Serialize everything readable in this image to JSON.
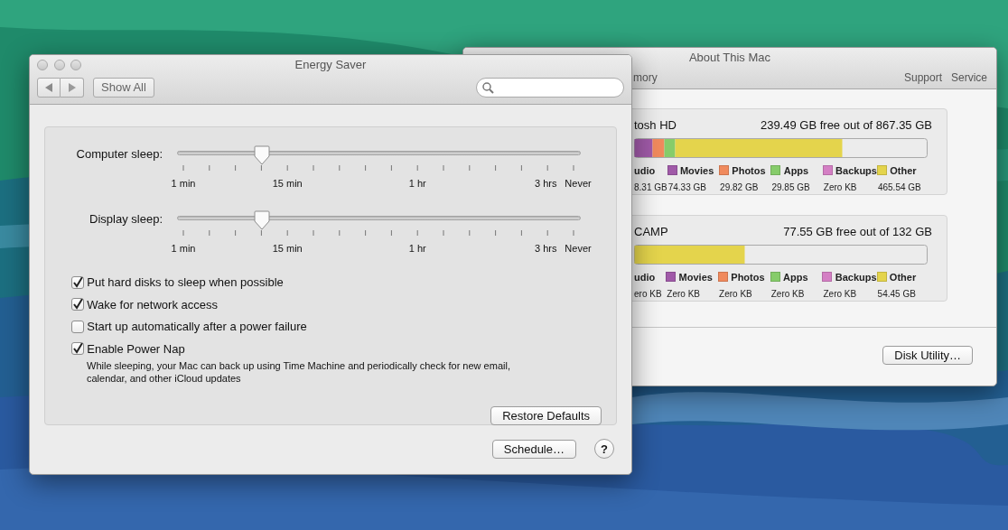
{
  "about_window": {
    "title": "About This Mac",
    "toolbar_left": [
      "mory"
    ],
    "toolbar_right": [
      "Support",
      "Service"
    ],
    "disks": [
      {
        "name": "tosh HD",
        "free": "239.49 GB free out of 867.35 GB",
        "legend": [
          {
            "label": "udio",
            "value": "8.31 GB"
          },
          {
            "label": "Movies",
            "value": "74.33 GB",
            "color": "#a05aa8"
          },
          {
            "label": "Photos",
            "value": "29.82 GB",
            "color": "#f08a5d"
          },
          {
            "label": "Apps",
            "value": "29.85 GB",
            "color": "#86cc6a"
          },
          {
            "label": "Backups",
            "value": "Zero KB",
            "color": "#d47fc4"
          },
          {
            "label": "Other",
            "value": "465.54 GB",
            "color": "#e4d44c"
          }
        ]
      },
      {
        "name": "CAMP",
        "free": "77.55 GB free out of 132 GB",
        "legend": [
          {
            "label": "udio",
            "value": "ero KB"
          },
          {
            "label": "Movies",
            "value": "Zero KB",
            "color": "#a05aa8"
          },
          {
            "label": "Photos",
            "value": "Zero KB",
            "color": "#f08a5d"
          },
          {
            "label": "Apps",
            "value": "Zero KB",
            "color": "#86cc6a"
          },
          {
            "label": "Backups",
            "value": "Zero KB",
            "color": "#d47fc4"
          },
          {
            "label": "Other",
            "value": "54.45 GB",
            "color": "#e4d44c"
          }
        ]
      }
    ],
    "button": "Disk Utility…"
  },
  "energy_window": {
    "title": "Energy Saver",
    "show_all": "Show All",
    "sliders": [
      {
        "label": "Computer sleep:",
        "level": 0.21,
        "ticks": [
          "1 min",
          "15 min",
          "1 hr",
          "3 hrs",
          "Never"
        ]
      },
      {
        "label": "Display sleep:",
        "level": 0.21,
        "ticks": [
          "1 min",
          "15 min",
          "1 hr",
          "3 hrs",
          "Never"
        ]
      }
    ],
    "checkboxes": [
      {
        "label": "Put hard disks to sleep when possible",
        "checked": true
      },
      {
        "label": "Wake for network access",
        "checked": true
      },
      {
        "label": "Start up automatically after a power failure",
        "checked": false
      },
      {
        "label": "Enable Power Nap",
        "checked": true,
        "description": "While sleeping, your Mac can back up using Time Machine and periodically check for new email, calendar, and other iCloud updates"
      }
    ],
    "restore_button": "Restore Defaults",
    "schedule_button": "Schedule…",
    "help_button": "?"
  }
}
